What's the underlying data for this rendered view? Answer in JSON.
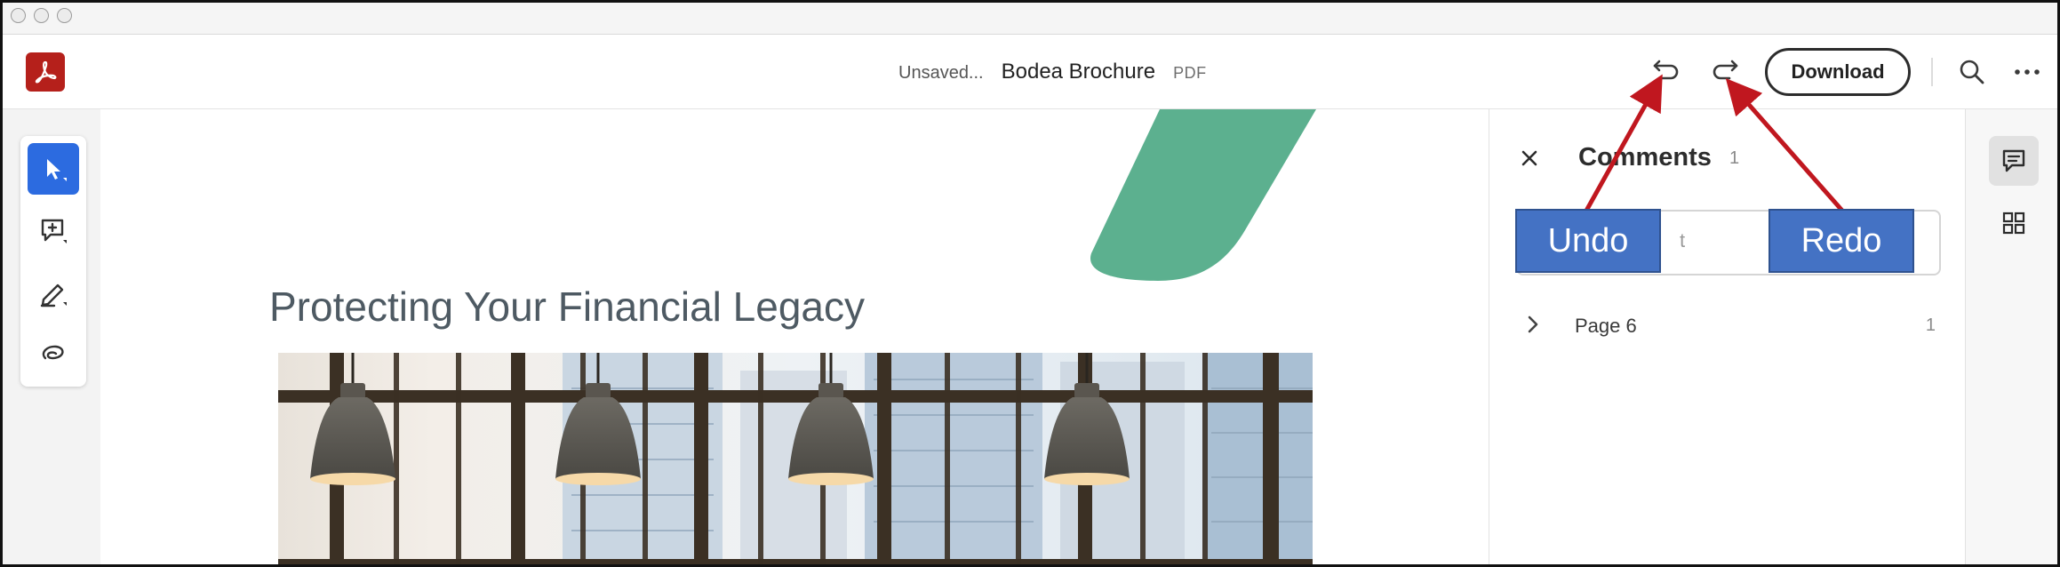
{
  "header": {
    "status": "Unsaved...",
    "document_title": "Bodea Brochure",
    "document_type": "PDF",
    "download_label": "Download"
  },
  "document": {
    "heading": "Protecting Your Financial Legacy"
  },
  "comments_panel": {
    "title": "Comments",
    "count": "1",
    "input_placeholder_visible": "t",
    "page_group": {
      "label": "Page 6",
      "count": "1"
    }
  },
  "annotations": {
    "undo_label": "Undo",
    "redo_label": "Redo",
    "color": "#4472c4",
    "arrow_color": "#c0171f"
  },
  "colors": {
    "brand_red": "#b5201b",
    "accent_blue": "#2c6be0",
    "shape_green": "#5cb08f"
  },
  "icons": {
    "undo": "undo-icon",
    "redo": "redo-icon",
    "search": "search-icon",
    "more": "more-icon",
    "select": "pointer-icon",
    "add_comment": "add-comment-icon",
    "draw": "pen-icon",
    "lasso": "lasso-icon",
    "close": "close-icon",
    "comments_rail": "comment-icon",
    "grid": "grid-icon"
  }
}
